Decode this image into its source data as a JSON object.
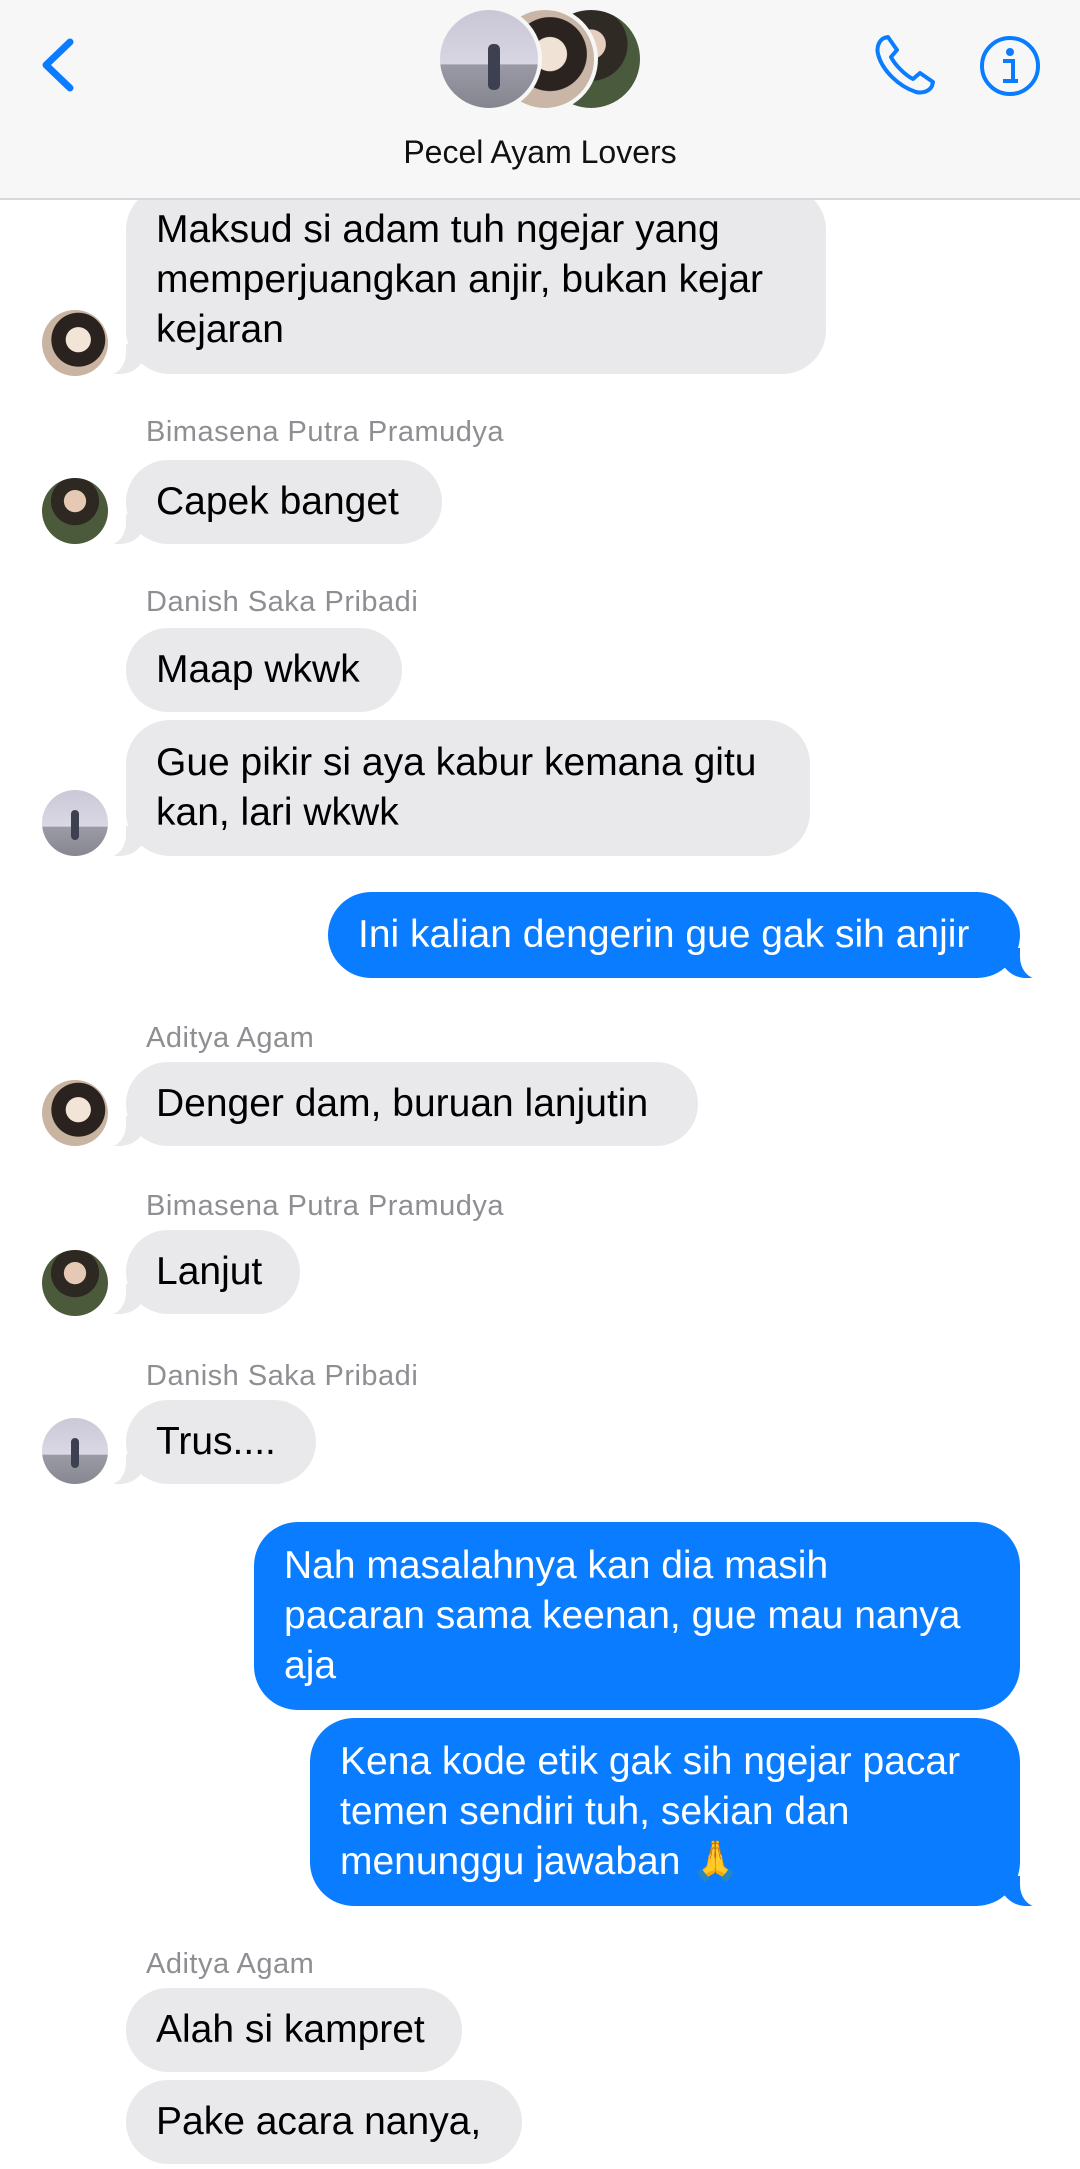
{
  "header": {
    "title": "Pecel Ayam Lovers",
    "back_icon": "chevron-left-icon",
    "call_icon": "phone-icon",
    "info_icon": "info-icon",
    "accent_color": "#0a7cff"
  },
  "messages": [
    {
      "sender": "",
      "direction": "incoming",
      "text": "Maksud si adam tuh ngejar yang\nmemperjuangkan anjir, bukan kejar\nkejaran"
    },
    {
      "sender": "Bimasena Putra Pramudya",
      "direction": "incoming",
      "text": "Capek banget"
    },
    {
      "sender": "Danish Saka Pribadi",
      "direction": "incoming",
      "text": "Maap wkwk"
    },
    {
      "sender": "",
      "direction": "incoming",
      "text": "Gue pikir si aya kabur kemana gitu\nkan, lari wkwk"
    },
    {
      "sender": "",
      "direction": "outgoing",
      "text": "Ini kalian dengerin gue gak sih anjir"
    },
    {
      "sender": "Aditya Agam",
      "direction": "incoming",
      "text": "Denger dam, buruan lanjutin"
    },
    {
      "sender": "Bimasena Putra Pramudya",
      "direction": "incoming",
      "text": "Lanjut"
    },
    {
      "sender": "Danish Saka Pribadi",
      "direction": "incoming",
      "text": "Trus...."
    },
    {
      "sender": "",
      "direction": "outgoing",
      "text": "Nah masalahnya kan dia masih\npacaran sama keenan, gue mau nanya\naja"
    },
    {
      "sender": "",
      "direction": "outgoing",
      "text": "Kena kode etik gak sih ngejar pacar\ntemen sendiri tuh, sekian dan\nmenunggu jawaban 🙏"
    },
    {
      "sender": "Aditya Agam",
      "direction": "incoming",
      "text": "Alah si kampret"
    },
    {
      "sender": "",
      "direction": "incoming",
      "text": "Pake acara nanya,"
    }
  ],
  "colors": {
    "incoming_bubble": "#e9e9eb",
    "outgoing_bubble": "#0a7cff",
    "sender_name": "#8e8e93"
  }
}
